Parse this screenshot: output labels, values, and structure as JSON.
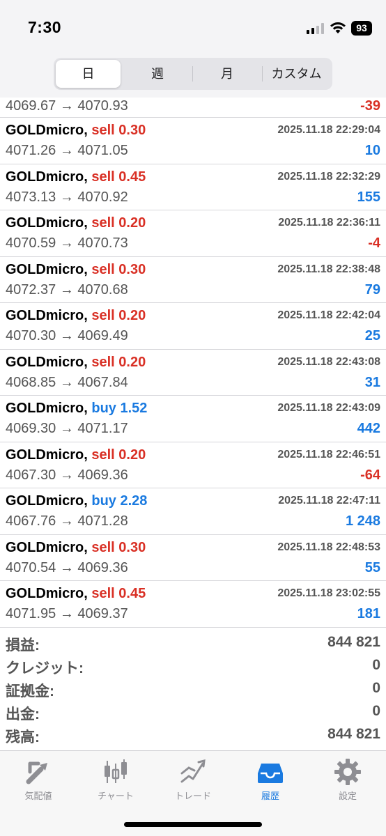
{
  "status_bar": {
    "time": "7:30",
    "battery": "93"
  },
  "period_tabs": [
    "日",
    "週",
    "月",
    "カスタム"
  ],
  "deals": [
    {
      "price": "4069.67 → 4070.93",
      "profit": "-39",
      "profit_sign": "neg"
    },
    {
      "symbol": "GOLDmicro,",
      "type": "sell 0.30",
      "side": "sell",
      "time": "2025.11.18 22:29:04",
      "price": "4071.26 → 4071.05",
      "profit": "10",
      "profit_sign": "pos"
    },
    {
      "symbol": "GOLDmicro,",
      "type": "sell 0.45",
      "side": "sell",
      "time": "2025.11.18 22:32:29",
      "price": "4073.13 → 4070.92",
      "profit": "155",
      "profit_sign": "pos"
    },
    {
      "symbol": "GOLDmicro,",
      "type": "sell 0.20",
      "side": "sell",
      "time": "2025.11.18 22:36:11",
      "price": "4070.59 → 4070.73",
      "profit": "-4",
      "profit_sign": "neg"
    },
    {
      "symbol": "GOLDmicro,",
      "type": "sell 0.30",
      "side": "sell",
      "time": "2025.11.18 22:38:48",
      "price": "4072.37 → 4070.68",
      "profit": "79",
      "profit_sign": "pos"
    },
    {
      "symbol": "GOLDmicro,",
      "type": "sell 0.20",
      "side": "sell",
      "time": "2025.11.18 22:42:04",
      "price": "4070.30 → 4069.49",
      "profit": "25",
      "profit_sign": "pos"
    },
    {
      "symbol": "GOLDmicro,",
      "type": "sell 0.20",
      "side": "sell",
      "time": "2025.11.18 22:43:08",
      "price": "4068.85 → 4067.84",
      "profit": "31",
      "profit_sign": "pos"
    },
    {
      "symbol": "GOLDmicro,",
      "type": "buy 1.52",
      "side": "buy",
      "time": "2025.11.18 22:43:09",
      "price": "4069.30 → 4071.17",
      "profit": "442",
      "profit_sign": "pos"
    },
    {
      "symbol": "GOLDmicro,",
      "type": "sell 0.20",
      "side": "sell",
      "time": "2025.11.18 22:46:51",
      "price": "4067.30 → 4069.36",
      "profit": "-64",
      "profit_sign": "neg"
    },
    {
      "symbol": "GOLDmicro,",
      "type": "buy 2.28",
      "side": "buy",
      "time": "2025.11.18 22:47:11",
      "price": "4067.76 → 4071.28",
      "profit": "1 248",
      "profit_sign": "pos"
    },
    {
      "symbol": "GOLDmicro,",
      "type": "sell 0.30",
      "side": "sell",
      "time": "2025.11.18 22:48:53",
      "price": "4070.54 → 4069.36",
      "profit": "55",
      "profit_sign": "pos"
    },
    {
      "symbol": "GOLDmicro,",
      "type": "sell 0.45",
      "side": "sell",
      "time": "2025.11.18 23:02:55",
      "price": "4071.95 → 4069.37",
      "profit": "181",
      "profit_sign": "pos"
    }
  ],
  "summary": [
    {
      "label": "損益:",
      "value": "844 821"
    },
    {
      "label": "クレジット:",
      "value": "0"
    },
    {
      "label": "証拠金:",
      "value": "0"
    },
    {
      "label": "出金:",
      "value": "0"
    },
    {
      "label": "残高:",
      "value": "844 821"
    }
  ],
  "tabbar": [
    {
      "label": "気配値",
      "icon": "quotes-icon"
    },
    {
      "label": "チャート",
      "icon": "chart-icon"
    },
    {
      "label": "トレード",
      "icon": "trade-icon"
    },
    {
      "label": "履歴",
      "icon": "history-icon",
      "active": true
    },
    {
      "label": "設定",
      "icon": "settings-icon"
    }
  ],
  "colors": {
    "sell": "#d93025",
    "buy": "#1a7ae0",
    "accent": "#1a7ae0",
    "muted": "#8e8e93"
  }
}
